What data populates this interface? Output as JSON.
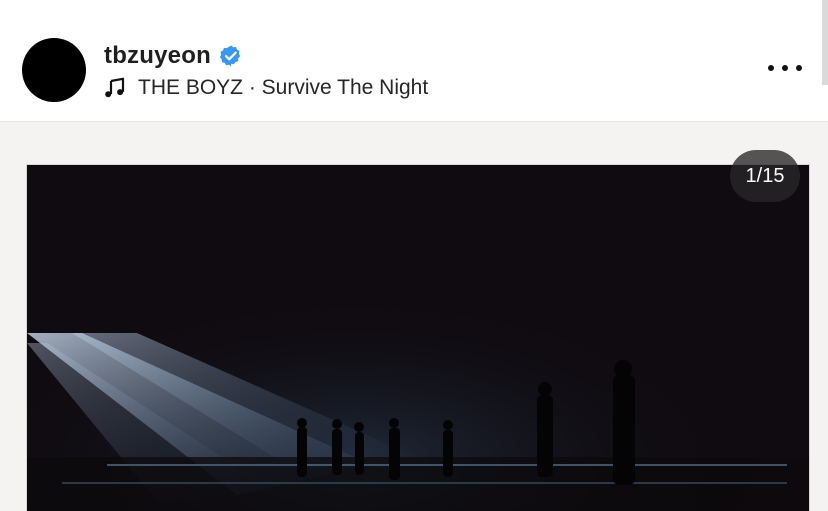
{
  "post": {
    "username": "tbzuyeon",
    "verified": true,
    "music": "THE BOYZ · Survive The Night",
    "media_counter": "1/15"
  },
  "icons": {
    "avatar": "avatar",
    "verified": "verified-badge-icon",
    "music": "music-note-icon",
    "more": "more-options-icon"
  },
  "colors": {
    "verified_blue": "#3897f0",
    "media_background": "#f4f3f1",
    "photo_dark": "#0f0a11",
    "spotlight": "#9fb9d8"
  }
}
